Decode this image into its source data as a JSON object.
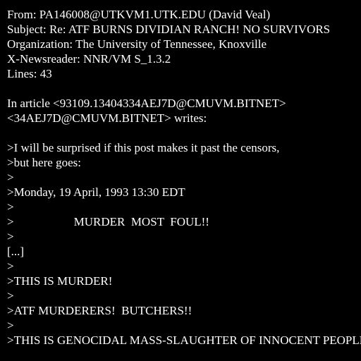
{
  "colors": {
    "background": "#000000",
    "text": "#ffffff"
  },
  "header": {
    "from": "From: PA146008@UTKVM1.UTK.EDU (David Veal)",
    "subject": "Subject: Re: ATF BURNS DIVIDIAN RANCH! NO SURVIVORS",
    "organization": "Organization: The University of Tennessee, Knoxville",
    "newsreader": "X-Newsreader: NNR/VM S_1.3.2",
    "lines": "Lines: 43"
  },
  "body": {
    "attribution_1": "In article <93109.13404334AEJ7D@CMUVM.BITNET>",
    "attribution_2": "<34AEJ7D@CMUVM.BITNET> writes:",
    "quote_1": ">I will be surprised if this post makes it past the censors,",
    "quote_2": ">but here goes:",
    "quote_3": ">",
    "quote_4": ">Monday, 19 April, 1993 13:30 EDT",
    "quote_5": ">",
    "quote_6": ">                    MURDER  MOST  FOUL!!",
    "quote_7": ">",
    "ellipsis": "[...]",
    "quote_8": ">",
    "quote_9": ">THIS IS MURDER!",
    "quote_10": ">",
    "quote_11": ">ATF MURDERERS!  BUTCHERS!!",
    "quote_12": ">",
    "quote_13": ">THIS IS GENOCIDAL MASS-SLAUGHTER OF INNOCENT PEOPLE!"
  }
}
